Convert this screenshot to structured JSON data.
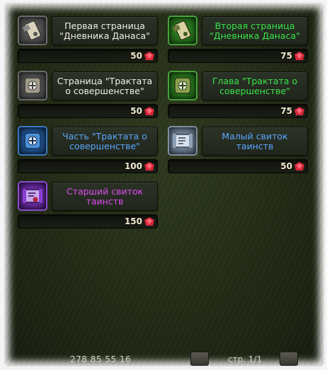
{
  "items": [
    {
      "name": "Первая страница \"Дневника Данаса\"",
      "price": "50",
      "color": "#f2efe4",
      "icon": "diary-page-gray-icon"
    },
    {
      "name": "Вторая страница \"Дневника Данаса\"",
      "price": "75",
      "color": "#39e34a",
      "icon": "diary-page-green-icon"
    },
    {
      "name": "Страница \"Трактата о совершенстве\"",
      "price": "50",
      "color": "#f2efe4",
      "icon": "treatise-page-gray-icon"
    },
    {
      "name": "Глава \"Трактата о совершенстве\"",
      "price": "75",
      "color": "#39e34a",
      "icon": "treatise-chapter-green-icon"
    },
    {
      "name": "Часть \"Трактата о совершенстве\"",
      "price": "100",
      "color": "#5aa8ff",
      "icon": "treatise-part-blue-icon"
    },
    {
      "name": "Малый свиток таинств",
      "price": "50",
      "color": "#5aa8ff",
      "icon": "minor-scroll-icon"
    },
    {
      "name": "Старший свиток таинств",
      "price": "150",
      "color": "#e04cf2",
      "icon": "major-scroll-icon"
    }
  ],
  "currency_icon": "ruby-gem-icon",
  "footer": {
    "currency_text": "278 85 55 16",
    "page_text": "стр. 1/1"
  }
}
